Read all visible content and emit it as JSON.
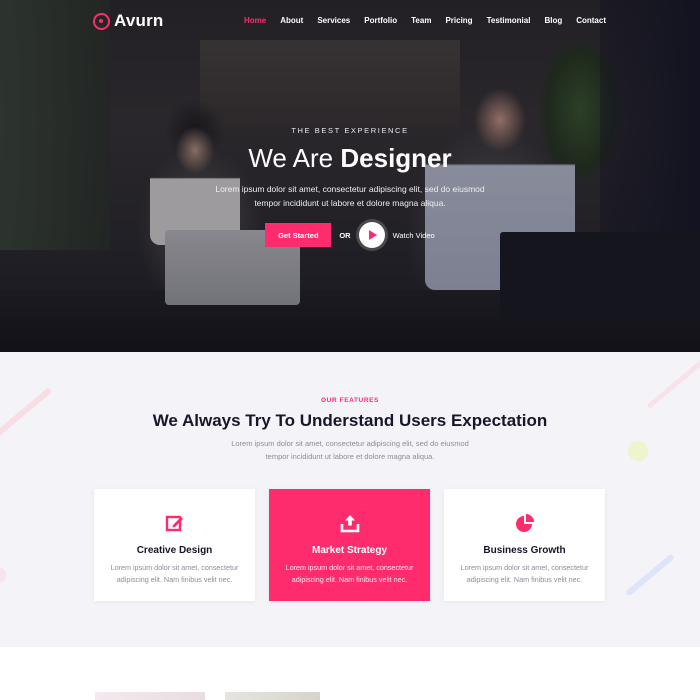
{
  "brand": {
    "name": "Avurn",
    "accent": "#ff2c6d"
  },
  "nav": {
    "items": [
      {
        "label": "Home",
        "active": true
      },
      {
        "label": "About",
        "active": false
      },
      {
        "label": "Services",
        "active": false
      },
      {
        "label": "Portfolio",
        "active": false
      },
      {
        "label": "Team",
        "active": false
      },
      {
        "label": "Pricing",
        "active": false
      },
      {
        "label": "Testimonial",
        "active": false
      },
      {
        "label": "Blog",
        "active": false
      },
      {
        "label": "Contact",
        "active": false
      }
    ]
  },
  "hero": {
    "eyebrow": "THE BEST EXPERIENCE",
    "title_lead": "We Are",
    "title_accent": "Designer",
    "description_line1": "Lorem ipsum dolor sit amet, consectetur adipiscing elit, sed do eiusmod",
    "description_line2": "tempor incididunt ut labore et dolore magna aliqua.",
    "cta_label": "Get Started",
    "or_label": "OR",
    "video_label": "Watch Video"
  },
  "features": {
    "eyebrow": "OUR FEATURES",
    "title_lead": "We Always Try To",
    "title_accent": "Understand",
    "title_tail": "Users Expectation",
    "description_line1": "Lorem ipsum dolor sit amet, consectetur adipiscing elit, sed do eiusmod",
    "description_line2": "tempor incididunt ut labore et dolore magna aliqua.",
    "cards": [
      {
        "icon": "edit-icon",
        "title": "Creative Design",
        "text_line1": "Lorem ipsum dolor sit amet, consectetur",
        "text_line2": "adipiscing elit. Nam finibus velit nec.",
        "active": false
      },
      {
        "icon": "upload-icon",
        "title": "Market Strategy",
        "text_line1": "Lorem ipsum dolor sit amet, consectetur",
        "text_line2": "adipiscing elit. Nam finibus velit nec.",
        "active": true
      },
      {
        "icon": "pie-chart-icon",
        "title": "Business Growth",
        "text_line1": "Lorem ipsum dolor sit amet, consectetur",
        "text_line2": "adipiscing elit. Nam finibus velit nec.",
        "active": false
      }
    ]
  }
}
